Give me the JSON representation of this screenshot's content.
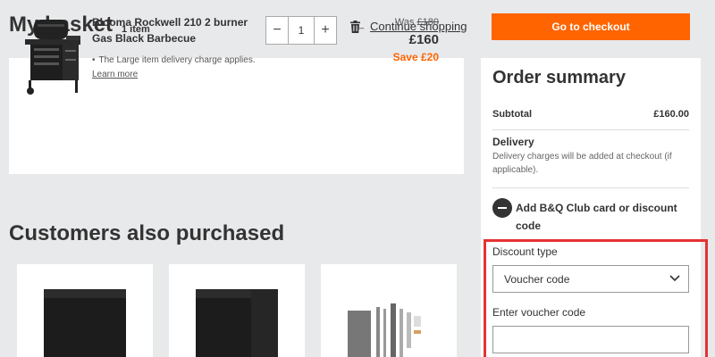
{
  "header": {
    "title": "My basket",
    "item_count": "1 item",
    "continue_arrow": "←",
    "continue_label": "Continue shopping",
    "checkout_label": "Go to checkout"
  },
  "basket": {
    "product_name": "Blooma Rockwell 210 2 burner Gas Black Barbecue",
    "note_text": "The Large item delivery charge applies.",
    "note_link": "Learn more",
    "quantity": "1",
    "qty_minus": "−",
    "qty_plus": "+",
    "was_label": "Was",
    "was_price": "£180",
    "price": "£160",
    "save": "Save £20"
  },
  "recommendations": {
    "title": "Customers also purchased"
  },
  "summary": {
    "title": "Order summary",
    "subtotal_label": "Subtotal",
    "subtotal_value": "£160.00",
    "delivery_label": "Delivery",
    "delivery_note": "Delivery charges will be added at checkout (if applicable).",
    "discount_label": "Add B&Q Club card or discount code",
    "discount_type_label": "Discount type",
    "discount_type_value": "Voucher code",
    "voucher_label": "Enter voucher code",
    "voucher_value": ""
  },
  "colors": {
    "accent": "#ff6400",
    "highlight": "#e63232",
    "background": "#e8e9eb"
  }
}
